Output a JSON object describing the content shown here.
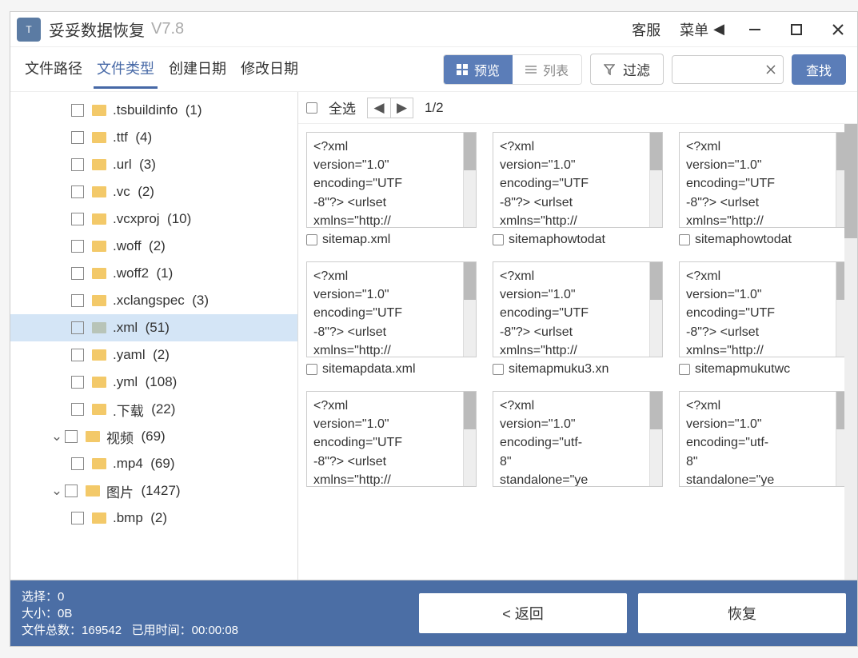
{
  "title": {
    "app_name": "妥妥数据恢复",
    "version": "V7.8"
  },
  "titlebar_right": {
    "service": "客服",
    "menu": "菜单"
  },
  "tabs": {
    "path": "文件路径",
    "type": "文件类型",
    "created": "创建日期",
    "modified": "修改日期"
  },
  "viewmode": {
    "preview": "预览",
    "list": "列表"
  },
  "filter_label": "过滤",
  "search_button": "查找",
  "content_header": {
    "select_all": "全选",
    "page": "1/2"
  },
  "tree": [
    {
      "label": ".tsbuildinfo",
      "count": "(1)",
      "indent": 2
    },
    {
      "label": ".ttf",
      "count": "(4)",
      "indent": 2
    },
    {
      "label": ".url",
      "count": "(3)",
      "indent": 2
    },
    {
      "label": ".vc",
      "count": "(2)",
      "indent": 2
    },
    {
      "label": ".vcxproj",
      "count": "(10)",
      "indent": 2
    },
    {
      "label": ".woff",
      "count": "(2)",
      "indent": 2
    },
    {
      "label": ".woff2",
      "count": "(1)",
      "indent": 2
    },
    {
      "label": ".xclangspec",
      "count": "(3)",
      "indent": 2
    },
    {
      "label": ".xml",
      "count": "(51)",
      "indent": 2,
      "selected": true,
      "gray": true
    },
    {
      "label": ".yaml",
      "count": "(2)",
      "indent": 2
    },
    {
      "label": ".yml",
      "count": "(108)",
      "indent": 2
    },
    {
      "label": ".下载",
      "count": "(22)",
      "indent": 2
    },
    {
      "label": "视频",
      "count": "(69)",
      "indent": 1,
      "chev": true
    },
    {
      "label": ".mp4",
      "count": "(69)",
      "indent": 2
    },
    {
      "label": "图片",
      "count": "(1427)",
      "indent": 1,
      "chev": true
    },
    {
      "label": ".bmp",
      "count": "(2)",
      "indent": 2
    }
  ],
  "thumbs": [
    {
      "text": "<?xml\nversion=\"1.0\"\nencoding=\"UTF\n-8\"?> <urlset\nxmlns=\"http://",
      "filename": "sitemap.xml"
    },
    {
      "text": "<?xml\nversion=\"1.0\"\nencoding=\"UTF\n-8\"?> <urlset\nxmlns=\"http://",
      "filename": "sitemaphowtodat"
    },
    {
      "text": "<?xml\nversion=\"1.0\"\nencoding=\"UTF\n-8\"?> <urlset\nxmlns=\"http://",
      "filename": "sitemaphowtodat"
    },
    {
      "text": "<?xml\nversion=\"1.0\"\nencoding=\"UTF\n-8\"?> <urlset\nxmlns=\"http://",
      "filename": "sitemapdata.xml"
    },
    {
      "text": "<?xml\nversion=\"1.0\"\nencoding=\"UTF\n-8\"?> <urlset\nxmlns=\"http://",
      "filename": "sitemapmuku3.xn"
    },
    {
      "text": "<?xml\nversion=\"1.0\"\nencoding=\"UTF\n-8\"?> <urlset\nxmlns=\"http://",
      "filename": "sitemapmukutwc"
    },
    {
      "text": "<?xml\nversion=\"1.0\"\nencoding=\"UTF\n-8\"?> <urlset\nxmlns=\"http://",
      "filename": ""
    },
    {
      "text": "<?xml\nversion=\"1.0\"\nencoding=\"utf-\n8\"\nstandalone=\"ye",
      "filename": ""
    },
    {
      "text": "<?xml\nversion=\"1.0\"\nencoding=\"utf-\n8\"\nstandalone=\"ye",
      "filename": ""
    }
  ],
  "footer": {
    "selected_label": "选择：",
    "selected_value": "0",
    "size_label": "大小：",
    "size_value": "0B",
    "total_label": "文件总数：",
    "total_value": "169542",
    "time_label": "已用时间：",
    "time_value": "00:00:08",
    "back": "< 返回",
    "recover": "恢复"
  }
}
